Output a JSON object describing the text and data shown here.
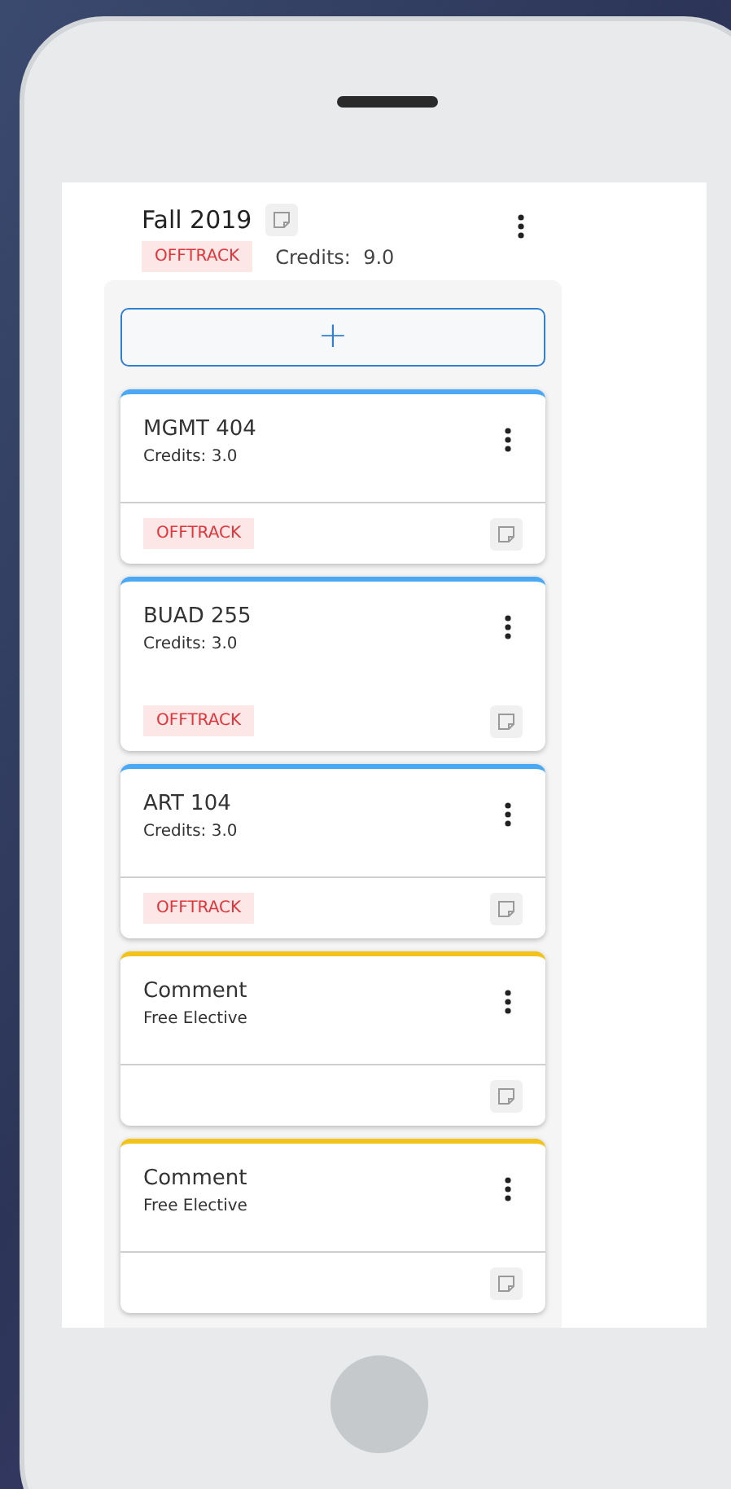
{
  "term": {
    "title": "Fall 2019",
    "status": "OFFTRACK",
    "credits_label": "Credits:",
    "credits": "9.0"
  },
  "add_button": {
    "label": "+"
  },
  "cards": [
    {
      "kind": "course",
      "title": "MGMT 404",
      "subtitle": "Credits: 3.0",
      "status": "OFFTRACK",
      "divided": true,
      "color": "#4aa8f5"
    },
    {
      "kind": "course",
      "title": "BUAD 255",
      "subtitle": "Credits: 3.0",
      "status": "OFFTRACK",
      "divided": false,
      "color": "#4aa8f5"
    },
    {
      "kind": "course",
      "title": "ART 104",
      "subtitle": "Credits: 3.0",
      "status": "OFFTRACK",
      "divided": true,
      "color": "#4aa8f5"
    },
    {
      "kind": "comment",
      "title": "Comment",
      "subtitle": "Free Elective",
      "divided": true,
      "color": "#f2c31b"
    },
    {
      "kind": "comment",
      "title": "Comment",
      "subtitle": "Free Elective",
      "divided": true,
      "color": "#f2c31b"
    }
  ]
}
